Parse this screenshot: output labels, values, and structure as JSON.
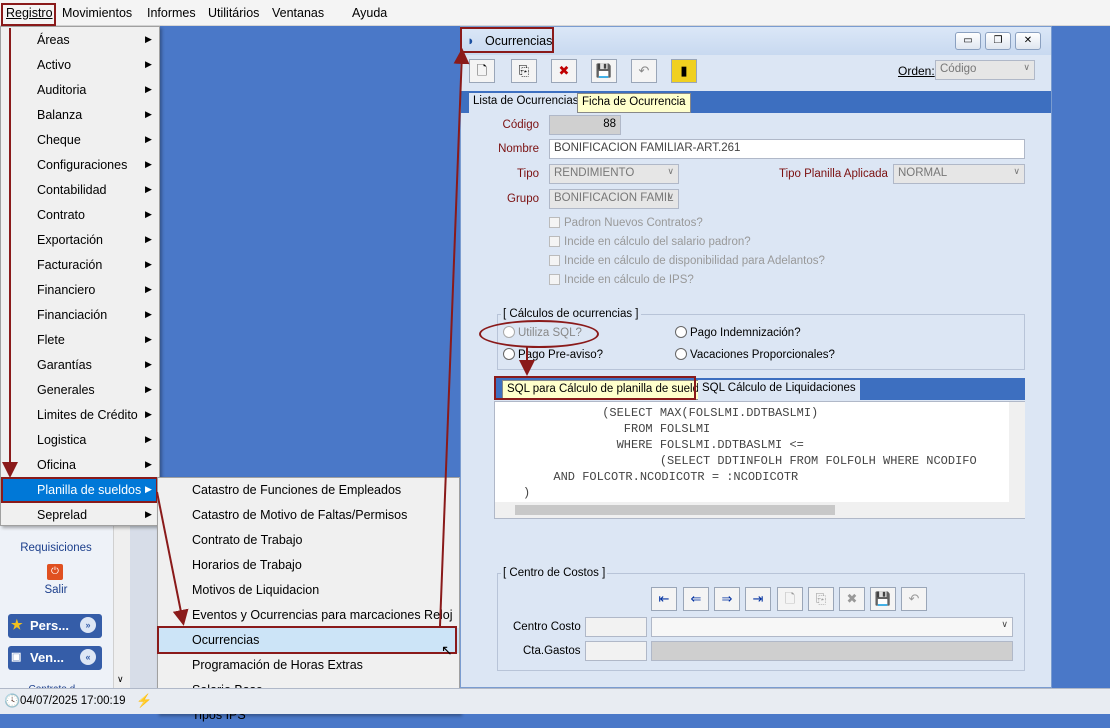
{
  "menubar": {
    "items": [
      "Registro",
      "Movimientos",
      "Informes",
      "Utilitários",
      "Ventanas",
      "Ayuda"
    ]
  },
  "menu": {
    "items": [
      "Áreas",
      "Activo",
      "Auditoria",
      "Balanza",
      "Cheque",
      "Configuraciones",
      "Contabilidad",
      "Contrato",
      "Exportación",
      "Facturación",
      "Financiero",
      "Financiación",
      "Flete",
      "Garantías",
      "Generales",
      "Limites de Crédito",
      "Logistica",
      "Oficina",
      "Planilla de sueldos",
      "Seprelad"
    ]
  },
  "submenu": {
    "items": [
      "Catastro de Funciones de Empleados",
      "Catastro de Motivo de Faltas/Permisos",
      "Contrato de Trabajo",
      "Horarios de Trabajo",
      "Motivos de Liquidacion",
      "Eventos y Ocurrencias para marcaciones Reloj",
      "Ocurrencias",
      "Programación de Horas Extras",
      "Salario Base",
      "Tipos IPS"
    ]
  },
  "sidebar": {
    "requisiciones": "Requisiciones",
    "salir": "Salir",
    "group1": "Pers...",
    "group2": "Ven...",
    "contrato": "Contrato d..."
  },
  "window": {
    "title": "Ocurrencias",
    "orden_label": "Orden:",
    "orden_value": "Código",
    "tabs": [
      "Lista de Ocurrencias",
      "Ficha de Ocurrencia"
    ],
    "form": {
      "codigo_label": "Código",
      "codigo_value": "88",
      "nombre_label": "Nombre",
      "nombre_value": "BONIFICACION FAMILIAR-ART.261",
      "tipo_label": "Tipo",
      "tipo_value": "RENDIMIENTO",
      "tipo_planilla_label": "Tipo Planilla Aplicada",
      "tipo_planilla_value": "NORMAL",
      "grupo_label": "Grupo",
      "grupo_value": "BONIFICACION FAMIL",
      "checks": [
        "Padron Nuevos Contratos?",
        "Incide en cálculo del salario padron?",
        "Incide en cálculo de disponibilidad para Adelantos?",
        "Incide en cálculo de IPS?"
      ]
    },
    "calculos": {
      "title": "[ Cálculos de ocurrencias ]",
      "utiliza_sql": "Utiliza SQL?",
      "pago_indemnizacion": "Pago Indemnización?",
      "pago_preaviso": "Pago Pre-aviso?",
      "vacaciones": "Vacaciones Proporcionales?"
    },
    "sql_tabs": [
      "SQL para Cálculo de planilla de sueldos",
      "SQL Cálculo de Liquidaciones"
    ],
    "sql_lines": [
      "      (SELECT MAX(FOLSLMI.DDTBASLMI)",
      "         FROM FOLSLMI",
      "        WHERE FOLSLMI.DDTBASLMI <=",
      "              (SELECT DDTINFOLH FROM FOLFOLH WHERE NCODIFO",
      "  AND FOLCOTR.NCODICOTR = :NCODICOTR",
      ")"
    ],
    "centro": {
      "title": "[ Centro de Costos ]",
      "centro_costo_label": "Centro Costo",
      "cta_gastos_label": "Cta.Gastos"
    }
  },
  "status": {
    "datetime": "04/07/2025 17:00:19"
  }
}
